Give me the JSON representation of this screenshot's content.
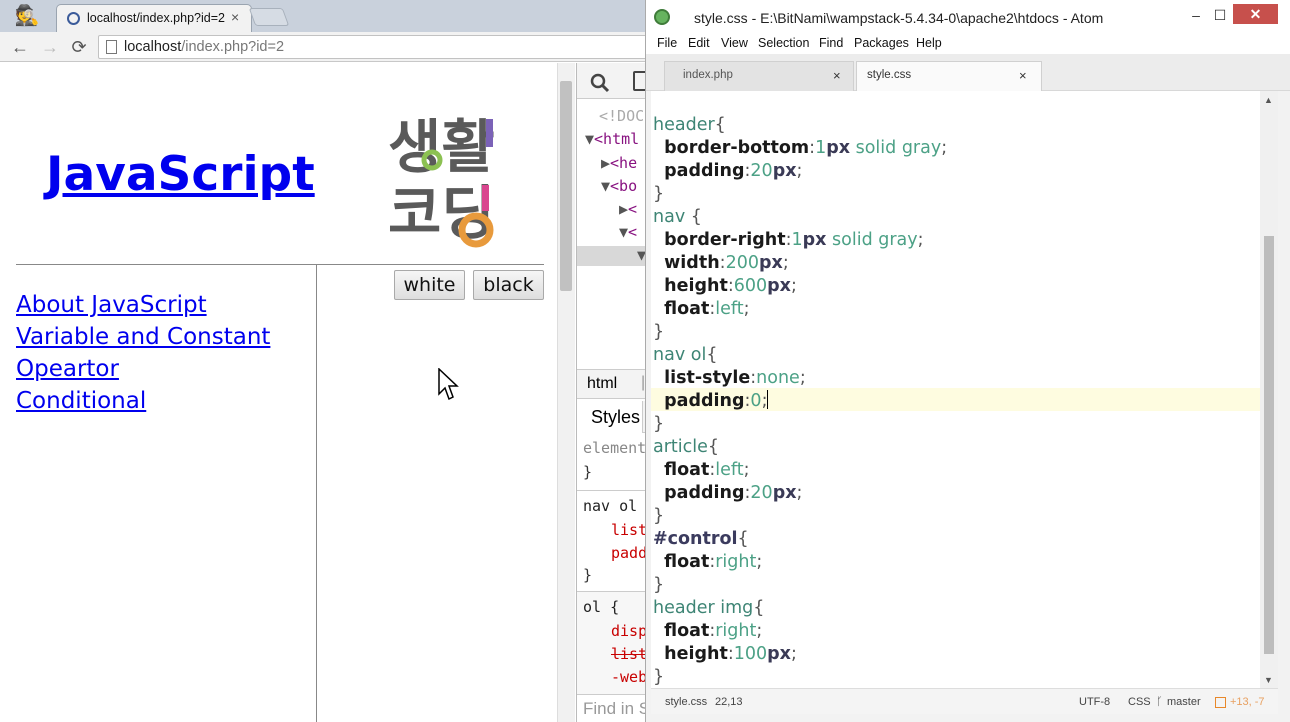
{
  "browser": {
    "tab_title": "localhost/index.php?id=2",
    "tab_close": "×",
    "url_host": "localhost",
    "url_path": "/index.php?id=2",
    "back": "←",
    "forward": "→",
    "reload": "⟳"
  },
  "page": {
    "title": "JavaScript",
    "logo_text_top": "생활",
    "logo_text_bottom": "코딩",
    "buttons": {
      "white": "white",
      "black": "black"
    },
    "nav": [
      "About JavaScript",
      "Variable and Constant",
      "Opeartor",
      "Conditional"
    ]
  },
  "devtools": {
    "dom_lines": [
      "<!DOC",
      "<html",
      "<he",
      "<bo",
      "<",
      "<"
    ],
    "tab_html": "html",
    "styles_tab": "Styles",
    "style_lines": [
      "element",
      "}",
      "nav ol",
      "list",
      "padd",
      "}",
      "ol {",
      "disp",
      "list",
      "-web"
    ],
    "find_placeholder": "Find in S"
  },
  "atom": {
    "title": "style.css - E:\\BitNami\\wampstack-5.4.34-0\\apache2\\htdocs - Atom",
    "window_controls": {
      "minimize": "–",
      "maximize": "☐",
      "close": "✕"
    },
    "menu": [
      "File",
      "Edit",
      "View",
      "Selection",
      "Find",
      "Packages",
      "Help"
    ],
    "tabs": [
      {
        "label": "index.php",
        "close": "×"
      },
      {
        "label": "style.css",
        "close": "×"
      }
    ],
    "code": {
      "l1_sel": "header",
      "l1_brace": "{",
      "l2_prop": "border-bottom",
      "l2_num": "1",
      "l2_unit": "px",
      "l2_rest": " solid gray",
      "l3_prop": "padding",
      "l3_num": "20",
      "l3_unit": "px",
      "close": "}",
      "l5_sel": "nav ",
      "l6_prop": "border-right",
      "l6_num": "1",
      "l6_unit": "px",
      "l6_rest": " solid gray",
      "l7_prop": "width",
      "l7_num": "200",
      "l7_unit": "px",
      "l8_prop": "height",
      "l8_num": "600",
      "l8_unit": "px",
      "l9_prop": "float",
      "l9_val": "left",
      "l11_sel": "nav ol",
      "l12_prop": "list-style",
      "l12_val": "none",
      "l13_prop": "padding",
      "l13_val": "0",
      "l15_sel": "article",
      "l16_prop": "float",
      "l16_val": "left",
      "l17_prop": "padding",
      "l17_num": "20",
      "l17_unit": "px",
      "l19_sel": "#control",
      "l20_prop": "float",
      "l20_val": "right",
      "l22_sel": "header img",
      "l23_prop": "float",
      "l23_val": "right",
      "l24_prop": "height",
      "l24_num": "100",
      "l24_unit": "px",
      "colon": ":",
      "semi": ";"
    },
    "status": {
      "file": "style.css",
      "cursor": "22,13",
      "encoding": "UTF-8",
      "grammar": "CSS",
      "branch": "master",
      "diff": "+13, -7"
    }
  },
  "colors": {
    "link": "#0000ee",
    "atom_close": "#c7504c",
    "logo_dark": "#5a5a5a",
    "logo_purple": "#7b62b7",
    "logo_green": "#8cc152",
    "logo_orange": "#e89a3c",
    "logo_pink": "#d9468f"
  }
}
